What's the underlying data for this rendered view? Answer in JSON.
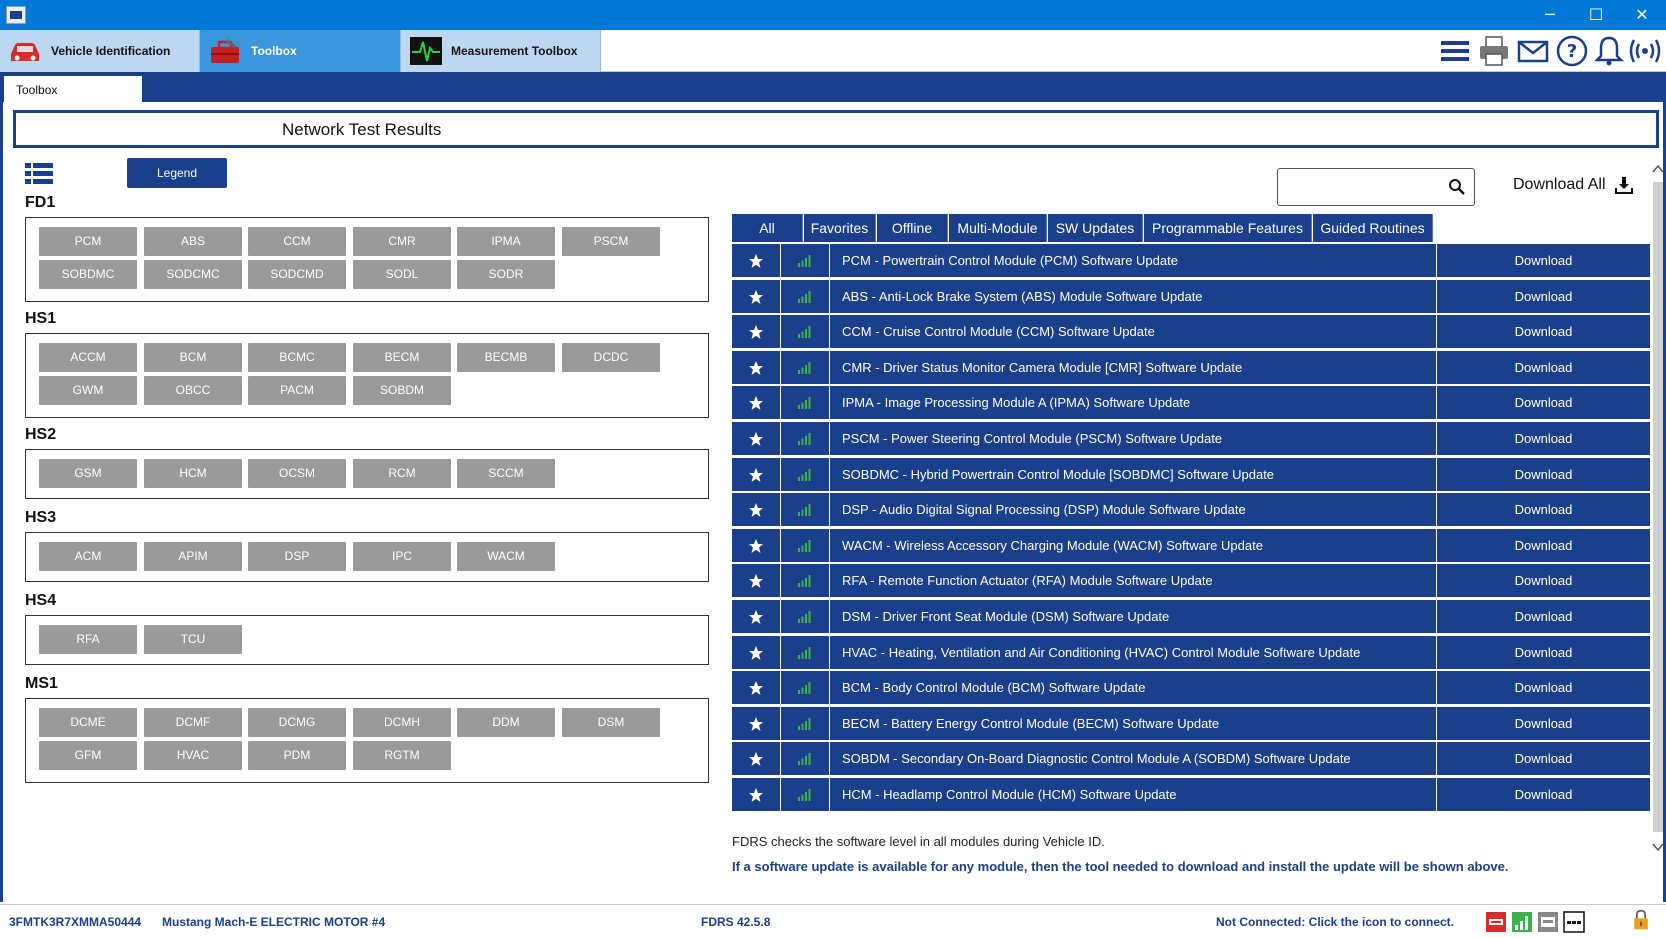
{
  "window": {
    "minimize": "─",
    "maximize": "☐",
    "close": "✕"
  },
  "top_tabs": [
    {
      "label": "Vehicle Identification",
      "icon": "car-icon",
      "active": false
    },
    {
      "label": "Toolbox",
      "icon": "toolbox-icon",
      "active": true
    },
    {
      "label": "Measurement Toolbox",
      "icon": "oscilloscope-icon",
      "active": false
    }
  ],
  "header_icons": [
    "menu-icon",
    "print-icon",
    "mail-icon",
    "help-icon",
    "bell-icon",
    "wireless-icon"
  ],
  "sub_tab": "Toolbox",
  "results_title": "Network Test Results",
  "legend_label": "Legend",
  "groups": [
    {
      "name": "FD1",
      "modules": [
        "PCM",
        "ABS",
        "CCM",
        "CMR",
        "IPMA",
        "PSCM",
        "SOBDMC",
        "SODCMC",
        "SODCMD",
        "SODL",
        "SODR"
      ]
    },
    {
      "name": "HS1",
      "modules": [
        "ACCM",
        "BCM",
        "BCMC",
        "BECM",
        "BECMB",
        "DCDC",
        "GWM",
        "OBCC",
        "PACM",
        "SOBDM"
      ]
    },
    {
      "name": "HS2",
      "modules": [
        "GSM",
        "HCM",
        "OCSM",
        "RCM",
        "SCCM"
      ]
    },
    {
      "name": "HS3",
      "modules": [
        "ACM",
        "APIM",
        "DSP",
        "IPC",
        "WACM"
      ]
    },
    {
      "name": "HS4",
      "modules": [
        "RFA",
        "TCU"
      ]
    },
    {
      "name": "MS1",
      "modules": [
        "DCME",
        "DCMF",
        "DCMG",
        "DCMH",
        "DDM",
        "DSM",
        "GFM",
        "HVAC",
        "PDM",
        "RGTM"
      ]
    }
  ],
  "search": {
    "value": "",
    "placeholder": ""
  },
  "download_all_label": "Download All",
  "filter_tabs": [
    "All",
    "Favorites",
    "Offline",
    "Multi-Module",
    "SW Updates",
    "Programmable Features",
    "Guided Routines"
  ],
  "updates": [
    {
      "description": "PCM - Powertrain Control Module (PCM) Software Update",
      "action": "Download"
    },
    {
      "description": "ABS - Anti-Lock Brake System (ABS) Module Software Update",
      "action": "Download"
    },
    {
      "description": "CCM - Cruise Control Module (CCM) Software Update",
      "action": "Download"
    },
    {
      "description": "CMR - Driver Status Monitor Camera Module [CMR] Software Update",
      "action": "Download"
    },
    {
      "description": "IPMA - Image Processing Module A (IPMA) Software Update",
      "action": "Download"
    },
    {
      "description": "PSCM - Power Steering Control Module (PSCM) Software Update",
      "action": "Download"
    },
    {
      "description": "SOBDMC - Hybrid Powertrain Control Module [SOBDMC] Software Update",
      "action": "Download"
    },
    {
      "description": "DSP - Audio Digital Signal Processing (DSP) Module Software Update",
      "action": "Download"
    },
    {
      "description": "WACM - Wireless Accessory Charging Module (WACM) Software Update",
      "action": "Download"
    },
    {
      "description": "RFA - Remote Function Actuator (RFA) Module Software Update",
      "action": "Download"
    },
    {
      "description": "DSM - Driver Front Seat Module (DSM) Software Update",
      "action": "Download"
    },
    {
      "description": "HVAC - Heating, Ventilation and Air Conditioning (HVAC) Control Module Software Update",
      "action": "Download"
    },
    {
      "description": "BCM - Body Control Module (BCM) Software Update",
      "action": "Download"
    },
    {
      "description": "BECM - Battery Energy Control Module (BECM) Software Update",
      "action": "Download"
    },
    {
      "description": "SOBDM - Secondary On-Board Diagnostic Control Module A (SOBDM) Software Update",
      "action": "Download"
    },
    {
      "description": "HCM - Headlamp Control Module (HCM) Software Update",
      "action": "Download"
    }
  ],
  "info_line1": "FDRS checks the software level in all modules during Vehicle ID.",
  "info_line2": "If a software update is available for any module, then the tool needed to download and install the update will be shown above.",
  "status": {
    "vin": "3FMTK3R7XMMA50444",
    "vehicle": "Mustang Mach-E ELECTRIC MOTOR #4",
    "version": "FDRS 42.5.8",
    "connection": "Not Connected: Click the icon to connect."
  },
  "colors": {
    "navy": "#1c3f8c",
    "titlebar": "#0078d7",
    "module_button": "#9a9a9a",
    "signal_green": "#3ab14a"
  }
}
